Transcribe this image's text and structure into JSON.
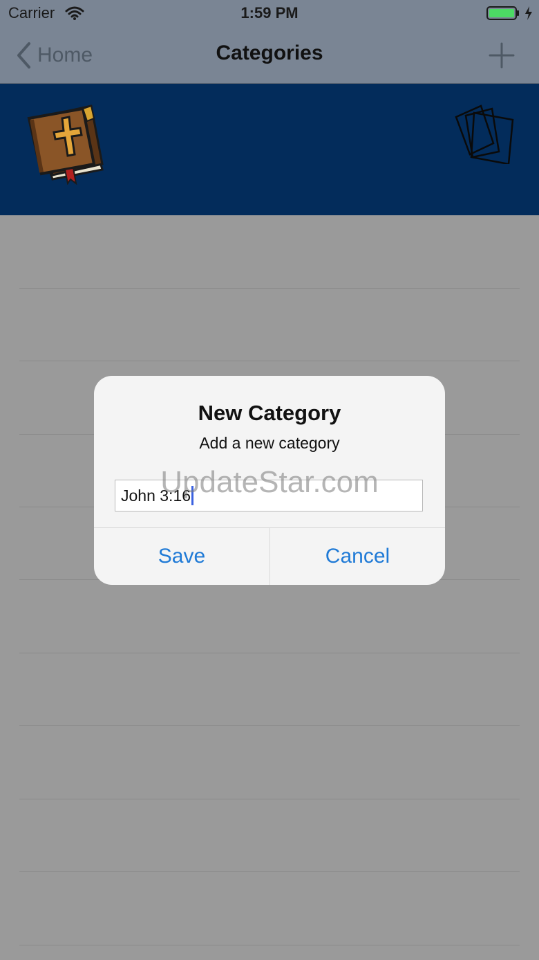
{
  "status_bar": {
    "carrier": "Carrier",
    "time": "1:59 PM",
    "battery_color": "#4cd964"
  },
  "nav_bar": {
    "back_label": "Home",
    "title": "Categories",
    "icons": {
      "back": "chevron-left-icon",
      "add": "plus-icon"
    }
  },
  "banner": {
    "background": "#032c5b",
    "left_icon": "bible-book-icon",
    "right_icon": "flashcards-icon"
  },
  "alert": {
    "title": "New Category",
    "message": "Add a new category",
    "input_value": "John 3:16",
    "buttons": {
      "save": "Save",
      "cancel": "Cancel"
    },
    "accent": "#1f7ad6"
  },
  "watermark": "UpdateStar.com"
}
